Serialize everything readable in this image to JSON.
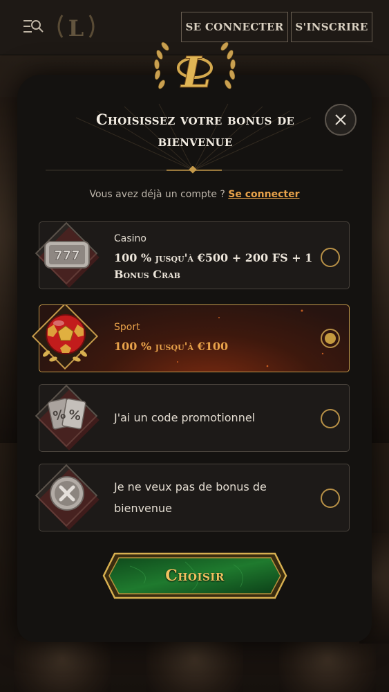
{
  "header": {
    "connect_label": "SE CONNECTER",
    "signup_label": "S'INSCRIRE"
  },
  "modal": {
    "title": "Choisissez votre bonus de bienvenue",
    "login_prompt": "Vous avez déjà un compte ?",
    "login_link": "Se connecter",
    "options": [
      {
        "category": "Casino",
        "title": "100 % jusqu'à €500 + 200 FS + 1 Bonus Crab",
        "icon": "slot-777-icon",
        "selected": false
      },
      {
        "category": "Sport",
        "title": "100 % jusqu'à €100",
        "icon": "soccer-ball-icon",
        "selected": true
      },
      {
        "category": "",
        "title": "J'ai un code promotionnel",
        "icon": "promo-percent-icon",
        "selected": false
      },
      {
        "category": "",
        "title": "Je ne veux pas de bonus de bienvenue",
        "icon": "no-bonus-x-icon",
        "selected": false
      }
    ],
    "choose_label": "Choisir"
  },
  "colors": {
    "accent_gold": "#c59a4a",
    "link_orange": "#e8a24a",
    "button_green": "#1f7a2e",
    "sport_orange": "#e8a24a"
  }
}
